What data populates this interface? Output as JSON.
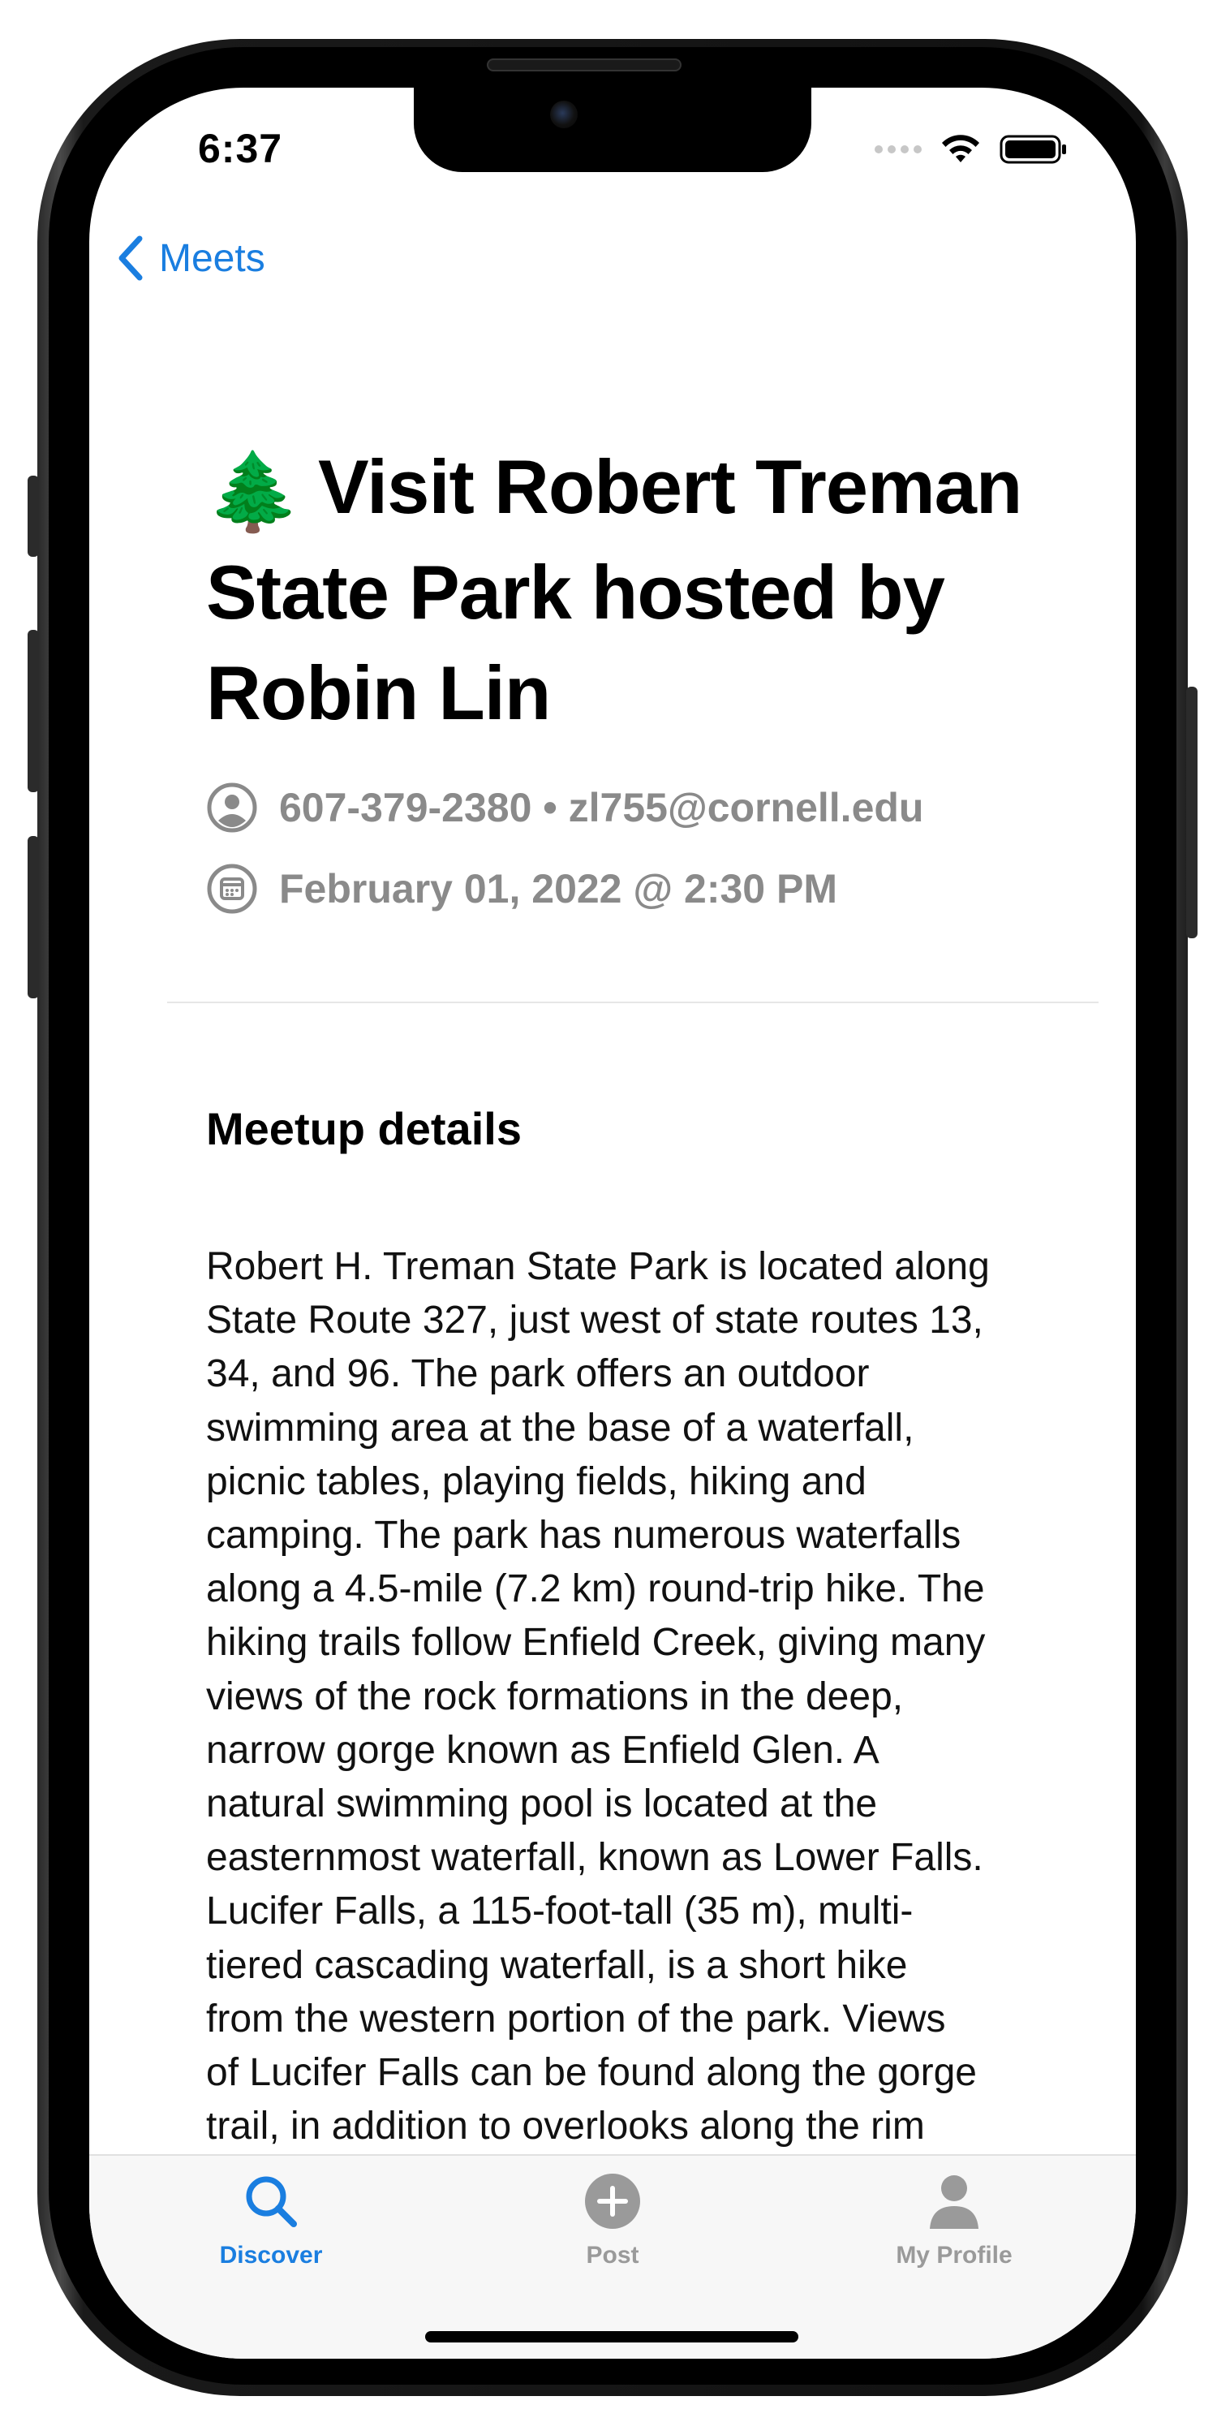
{
  "status_bar": {
    "time": "6:37"
  },
  "nav": {
    "back_label": "Meets"
  },
  "meetup": {
    "emoji": "🌲",
    "title": "Visit Robert Treman State Park hosted by Robin Lin",
    "contact": "607-379-2380 • zl755@cornell.edu",
    "datetime": "February 01, 2022 @ 2:30 PM",
    "section_title": "Meetup details",
    "details": "Robert H. Treman State Park is located along\nState Route 327, just west of state routes 13,\n34, and 96. The park offers an outdoor\nswimming area at the base of a waterfall,\npicnic tables, playing fields, hiking and\ncamping.  The park has numerous waterfalls\nalong a 4.5-mile (7.2 km) round-trip hike. The\nhiking trails follow Enfield Creek, giving many\nviews of the rock formations in the deep,\nnarrow gorge known as Enfield Glen. A\nnatural swimming pool is located at the\neasternmost waterfall, known as Lower Falls.\nLucifer Falls, a 115-foot-tall (35 m), multi-\ntiered cascading waterfall, is a short hike\nfrom the western portion of the park. Views\nof Lucifer Falls can be found along the gorge\ntrail, in addition to overlooks along the rim"
  },
  "tabbar": {
    "tabs": [
      {
        "label": "Discover",
        "icon": "search-icon",
        "active": true
      },
      {
        "label": "Post",
        "icon": "plus-circle-icon",
        "active": false
      },
      {
        "label": "My Profile",
        "icon": "person-icon",
        "active": false
      }
    ]
  },
  "colors": {
    "accent": "#1a7ee0",
    "muted": "#8a8a8a",
    "inactive_tab": "#9a9a9a"
  }
}
